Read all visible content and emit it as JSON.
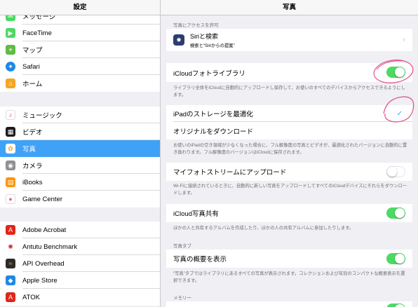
{
  "left": {
    "title": "設定",
    "items": [
      {
        "label": "メッセージ",
        "icon": "messages-icon",
        "color": "#4cd964"
      },
      {
        "label": "FaceTime",
        "icon": "facetime-icon",
        "color": "#4cd964"
      },
      {
        "label": "マップ",
        "icon": "maps-icon",
        "color": "#62bb47"
      },
      {
        "label": "Safari",
        "icon": "safari-icon",
        "color": "#1e88e5"
      },
      {
        "label": "ホーム",
        "icon": "home-icon",
        "color": "#f5a623"
      },
      {
        "label": "ミュージック",
        "icon": "music-icon",
        "color": "#fc3c44"
      },
      {
        "label": "ビデオ",
        "icon": "video-icon",
        "color": "#1c1c1e"
      },
      {
        "label": "写真",
        "icon": "photos-icon",
        "color": "#ffffff"
      },
      {
        "label": "カメラ",
        "icon": "camera-icon",
        "color": "#8e8e93"
      },
      {
        "label": "iBooks",
        "icon": "ibooks-icon",
        "color": "#ff9500"
      },
      {
        "label": "Game Center",
        "icon": "game-center-icon",
        "color": "#ffffff"
      },
      {
        "label": "Adobe Acrobat",
        "icon": "adobe-acrobat-icon",
        "color": "#e1251b"
      },
      {
        "label": "Antutu Benchmark",
        "icon": "antutu-icon",
        "color": "#ffffff"
      },
      {
        "label": "API Overhead",
        "icon": "api-overhead-icon",
        "color": "#2b2b2b"
      },
      {
        "label": "Apple Store",
        "icon": "apple-store-icon",
        "color": "#1e88e5"
      },
      {
        "label": "ATOK",
        "icon": "atok-icon",
        "color": "#e1251b"
      }
    ]
  },
  "right": {
    "title": "写真",
    "access_header": "写真にアクセスを許可",
    "siri_title": "Siriと検索",
    "siri_subtitle": "検索と“Siriからの提案”",
    "icloud_library_label": "iCloudフォトライブラリ",
    "icloud_library_on": true,
    "icloud_library_footer": "ライブラリ全体をiCloudに自動的にアップロードし保存して、お使いのすべてのデバイスからアクセスできるようにします。",
    "optimize_label": "iPadのストレージを最適化",
    "optimize_selected": true,
    "download_label": "オリジナルをダウンロード",
    "storage_footer": "お使いのiPadの空き領域が少なくなった場合に、フル解像度の写真とビデオが、最適化されたバージョンに自動的に置き換わります。フル解像度のバージョンはiCloudに保存されます。",
    "photostream_label": "マイフォトストリームにアップロード",
    "photostream_on": false,
    "photostream_footer": "Wi-Fiに接続されているときに、自動的に新しい写真をアップロードしてすべてのiCloudデバイスにそれらをダウンロードします。",
    "shared_label": "iCloud写真共有",
    "shared_on": true,
    "shared_footer": "ほかの人と共有するアルバムを作成したり、ほかの人の共有アルバムに参加したりします。",
    "photos_tab_header": "写真タブ",
    "summary_label": "写真の概要を表示",
    "summary_on": true,
    "summary_footer": "“写真”タブではライブラリにあるすべての写真が表示されます。コレクションおよび年別のコンパクトな概要表示を選択できます。",
    "memories_header": "メモリー"
  },
  "colors": {
    "accent": "#3fa2f7",
    "toggle_on": "#4cd964",
    "annotation": "#e0508a"
  }
}
